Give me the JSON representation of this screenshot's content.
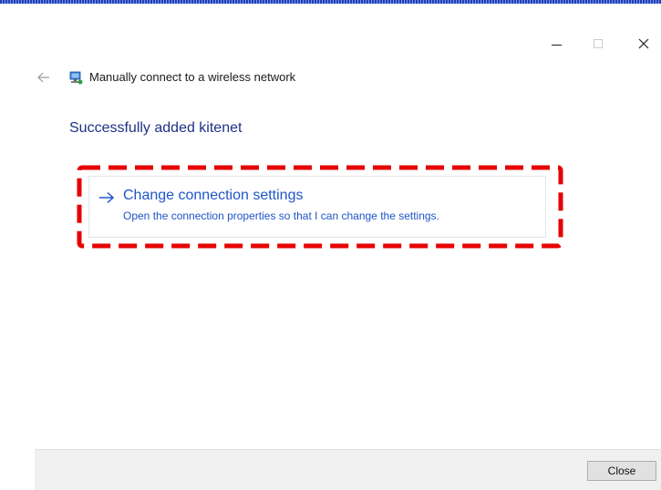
{
  "window": {
    "controls": {
      "minimize_icon": "minimize-icon",
      "maximize_icon": "maximize-icon",
      "close_icon": "close-icon"
    }
  },
  "header": {
    "back_icon": "back-arrow-icon",
    "network_icon": "wireless-network-icon",
    "title": "Manually connect to a wireless network"
  },
  "main": {
    "heading": "Successfully added kitenet",
    "option": {
      "arrow_icon": "right-arrow-icon",
      "title": "Change connection settings",
      "description": "Open the connection properties so that I can change the settings."
    },
    "highlight_color": "#e60000"
  },
  "footer": {
    "close_label": "Close"
  },
  "colors": {
    "heading": "#1e3287",
    "link": "#1e55c8",
    "footer_bg": "#f0f0f0"
  }
}
